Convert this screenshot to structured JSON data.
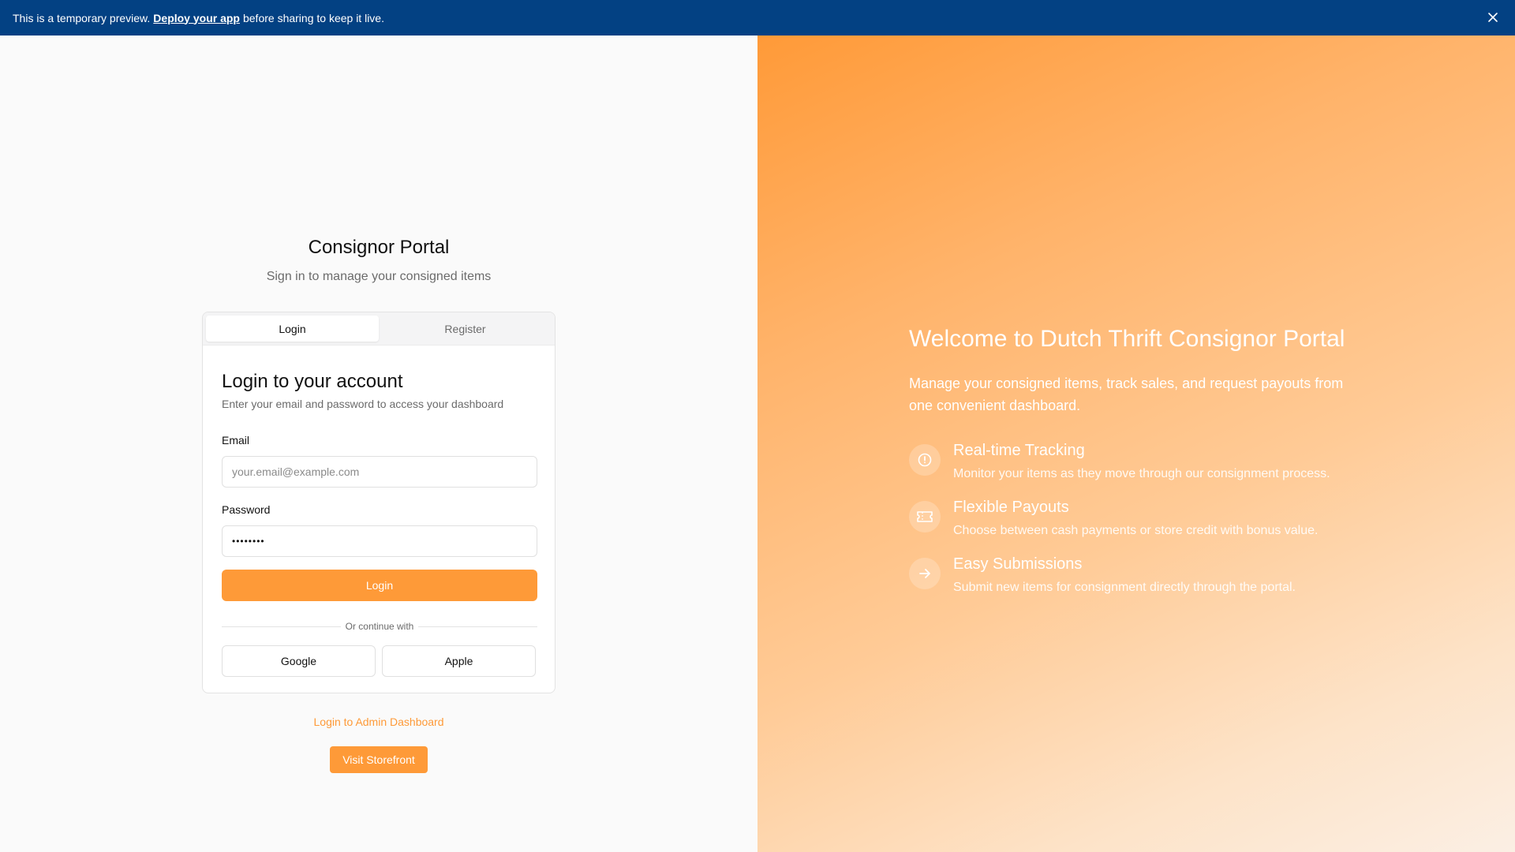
{
  "banner": {
    "text_before": "This is a temporary preview.",
    "link": "Deploy your app",
    "text_after": "before sharing to keep it live.",
    "bg_color": "#034183"
  },
  "portal": {
    "title": "Consignor Portal",
    "subtitle": "Sign in to manage your consigned items"
  },
  "tabs": [
    {
      "label": "Login",
      "active": true
    },
    {
      "label": "Register",
      "active": false
    }
  ],
  "login_form": {
    "heading": "Login to your account",
    "description": "Enter your email and password to access your dashboard",
    "email_label": "Email",
    "email_placeholder": "your.email@example.com",
    "password_label": "Password",
    "password_value": "••••••••",
    "submit_label": "Login",
    "divider_text": "Or continue with",
    "google_label": "Google",
    "apple_label": "Apple"
  },
  "links": {
    "admin": "Login to Admin Dashboard",
    "storefront": "Visit Storefront"
  },
  "hero": {
    "title": "Welcome to Dutch Thrift Consignor Portal",
    "subtitle": "Manage your consigned items, track sales, and request payouts from one convenient dashboard.",
    "features": [
      {
        "icon": "clock-icon",
        "title": "Real-time Tracking",
        "desc": "Monitor your items as they move through our consignment process."
      },
      {
        "icon": "ticket-icon",
        "title": "Flexible Payouts",
        "desc": "Choose between cash payments or store credit with bonus value."
      },
      {
        "icon": "arrow-right-icon",
        "title": "Easy Submissions",
        "desc": "Submit new items for consignment directly through the portal."
      }
    ]
  },
  "colors": {
    "accent": "#fe9a38"
  }
}
